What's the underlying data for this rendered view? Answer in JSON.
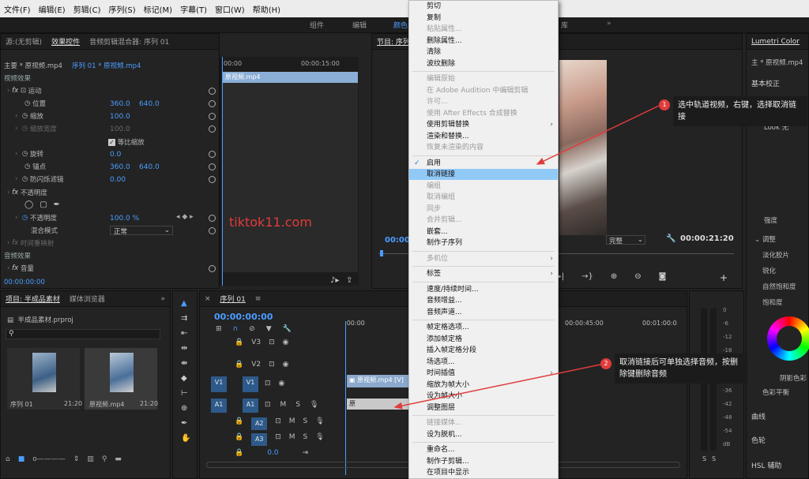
{
  "menubar": [
    "文件(F)",
    "编辑(E)",
    "剪辑(C)",
    "序列(S)",
    "标记(M)",
    "字幕(T)",
    "窗口(W)",
    "帮助(H)"
  ],
  "workspace_tabs": [
    "组件",
    "编辑",
    "颜色",
    "库"
  ],
  "source_panel": {
    "tab_source": "源:(无剪辑)",
    "tab_effect_controls": "效果控件",
    "tab_audio_mixer": "音频剪辑混合器: 序列 01",
    "master_clip": "主要 * 原视频.mp4",
    "sequence_clip": "序列 01 * 原视频.mp4",
    "timeline_start": "00:00",
    "timeline_mid": "00:00:15:00",
    "clip_name": "原视频.mp4",
    "section_video": "视频效果",
    "motion": "运动",
    "position_label": "位置",
    "position_x": "360.0",
    "position_y": "640.0",
    "scale_label": "缩放",
    "scale_value": "100.0",
    "scale_width_label": "缩放宽度",
    "scale_width_value": "100.0",
    "uniform_scale": "等比缩放",
    "rotation_label": "旋转",
    "rotation_value": "0.0",
    "anchor_label": "锚点",
    "anchor_x": "360.0",
    "anchor_y": "640.0",
    "antiflicker_label": "防闪烁滤镜",
    "antiflicker_value": "0.00",
    "opacity_section": "不透明度",
    "opacity_label": "不透明度",
    "opacity_value": "100.0 %",
    "blend_label": "混合模式",
    "blend_value": "正常",
    "time_remap": "时间重映射",
    "section_audio": "音频效果",
    "volume_label": "音量",
    "timecode": "00:00:00:00"
  },
  "program_panel": {
    "title": "节目: 序列",
    "timecode_left": "00:00",
    "quality": "完整",
    "timecode_right": "00:00:21:20"
  },
  "lumetri": {
    "title": "Lumetri Color",
    "master": "主 * 原视频.mp4",
    "basic": "基本校正",
    "look_label": "Look",
    "look_value": "无",
    "intensity": "强度",
    "adjust": "调整",
    "faded_film": "淡化胶片",
    "sharpen": "锐化",
    "natural_saturation": "自然饱和度",
    "saturation": "饱和度",
    "shadow_color": "阴影色彩",
    "color_wheels": "色彩平衡",
    "curves": "曲线",
    "color_wheel_title": "色轮",
    "hsl": "HSL 辅助"
  },
  "project_panel": {
    "tab_project": "项目: 半成品素材",
    "tab_media": "媒体浏览器",
    "file": "半成品素材.prproj",
    "item1_name": "序列 01",
    "item1_dur": "21:20",
    "item2_name": "原视频.mp4",
    "item2_dur": "21:20"
  },
  "timeline": {
    "tab": "序列 01",
    "timecode": "00:00:00:00",
    "ruler_start": ":00:00",
    "ruler_45": "00:00:45:00",
    "ruler_100": "00:01:00:0",
    "tracks": [
      "V3",
      "V2",
      "V1",
      "A1",
      "A2",
      "A3"
    ],
    "src_v1": "V1",
    "src_a1": "A1",
    "master_value": "0.0",
    "clip_video": "原视频.mp4 [V]",
    "clip_audio": "原"
  },
  "meters": {
    "scale": [
      "0",
      "-6",
      "-12",
      "-18",
      "-24",
      "-30",
      "-36",
      "-42",
      "-48",
      "-54",
      "dB"
    ],
    "solo": "S"
  },
  "watermark": "tiktok11.com",
  "context_menu": {
    "items": [
      {
        "label": "剪切",
        "disabled": false
      },
      {
        "label": "复制",
        "disabled": false
      },
      {
        "label": "粘贴属性...",
        "disabled": true
      },
      {
        "label": "删除属性...",
        "disabled": false
      },
      {
        "label": "清除",
        "disabled": false
      },
      {
        "label": "波纹删除",
        "disabled": false
      },
      {
        "label": "编辑原始",
        "disabled": true
      },
      {
        "label": "在 Adobe Audition 中编辑剪辑",
        "disabled": true
      },
      {
        "label": "许可...",
        "disabled": true
      },
      {
        "label": "使用 After Effects 合成替换",
        "disabled": true
      },
      {
        "label": "使用剪辑替换",
        "disabled": false,
        "submenu": true
      },
      {
        "label": "渲染和替换...",
        "disabled": false
      },
      {
        "label": "恢复未渲染的内容",
        "disabled": true
      },
      {
        "label": "启用",
        "disabled": false,
        "checked": true
      },
      {
        "label": "取消链接",
        "disabled": false,
        "highlight": true
      },
      {
        "label": "编组",
        "disabled": true
      },
      {
        "label": "取消编组",
        "disabled": true
      },
      {
        "label": "同步",
        "disabled": true
      },
      {
        "label": "合并剪辑...",
        "disabled": true
      },
      {
        "label": "嵌套...",
        "disabled": false
      },
      {
        "label": "制作子序列",
        "disabled": false
      },
      {
        "label": "多机位",
        "disabled": true,
        "submenu": true
      },
      {
        "label": "标签",
        "disabled": false,
        "submenu": true
      },
      {
        "label": "速度/持续时间...",
        "disabled": false
      },
      {
        "label": "音频增益...",
        "disabled": false
      },
      {
        "label": "音频声道...",
        "disabled": false
      },
      {
        "label": "帧定格选项...",
        "disabled": false
      },
      {
        "label": "添加帧定格",
        "disabled": false
      },
      {
        "label": "插入帧定格分段",
        "disabled": false
      },
      {
        "label": "场选项...",
        "disabled": false
      },
      {
        "label": "时间插值",
        "disabled": false,
        "submenu": true
      },
      {
        "label": "缩放为帧大小",
        "disabled": false
      },
      {
        "label": "设为帧大小",
        "disabled": false
      },
      {
        "label": "调整图层",
        "disabled": false
      },
      {
        "label": "链接媒体...",
        "disabled": true
      },
      {
        "label": "设为脱机...",
        "disabled": false
      },
      {
        "label": "重命名...",
        "disabled": false
      },
      {
        "label": "制作子剪辑...",
        "disabled": false
      },
      {
        "label": "在项目中显示",
        "disabled": false
      },
      {
        "label": "在资源管理器中显示...",
        "disabled": false
      }
    ]
  },
  "annotations": {
    "note1_num": "1",
    "note1_text": "选中轨道视频，右键，选择取消链接",
    "note2_num": "2",
    "note2_text": "取消链接后可单独选择音频，按删除键删除音频"
  },
  "colors": {
    "accent_blue": "#4b9dff",
    "highlight": "#91c9f7",
    "annotation_red": "#e03c3c"
  }
}
